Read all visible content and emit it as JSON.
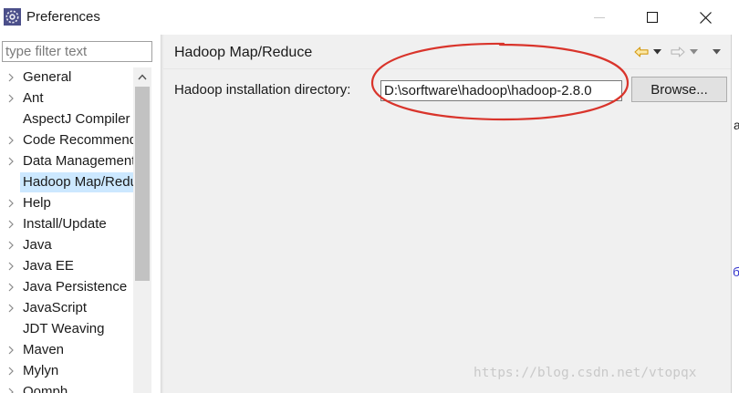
{
  "window": {
    "title": "Preferences"
  },
  "sidebar": {
    "filter_placeholder": "type filter text",
    "items": [
      {
        "label": "General",
        "expandable": true
      },
      {
        "label": "Ant",
        "expandable": true
      },
      {
        "label": "AspectJ Compiler",
        "expandable": false
      },
      {
        "label": "Code Recommenders",
        "expandable": true
      },
      {
        "label": "Data Management",
        "expandable": true
      },
      {
        "label": "Hadoop Map/Reduce",
        "expandable": false,
        "selected": true
      },
      {
        "label": "Help",
        "expandable": true
      },
      {
        "label": "Install/Update",
        "expandable": true
      },
      {
        "label": "Java",
        "expandable": true
      },
      {
        "label": "Java EE",
        "expandable": true
      },
      {
        "label": "Java Persistence",
        "expandable": true
      },
      {
        "label": "JavaScript",
        "expandable": true
      },
      {
        "label": "JDT Weaving",
        "expandable": false
      },
      {
        "label": "Maven",
        "expandable": true
      },
      {
        "label": "Mylyn",
        "expandable": true
      },
      {
        "label": "Oomph",
        "expandable": true
      }
    ]
  },
  "main": {
    "page_title": "Hadoop Map/Reduce",
    "install_dir_label": "Hadoop installation directory:",
    "install_dir_value": "D:\\sorftware\\hadoop\\hadoop-2.8.0",
    "browse_label": "Browse..."
  },
  "icons": {
    "back": "back-arrow-icon",
    "forward": "forward-arrow-icon",
    "menu": "view-menu-icon"
  },
  "colors": {
    "selection": "#cce8ff",
    "annotation_ellipse": "#d9342b",
    "back_arrow": "#e0a020"
  },
  "watermark": "https://blog.csdn.net/vtopqx",
  "edge_glyphs": [
    "a",
    "б"
  ]
}
